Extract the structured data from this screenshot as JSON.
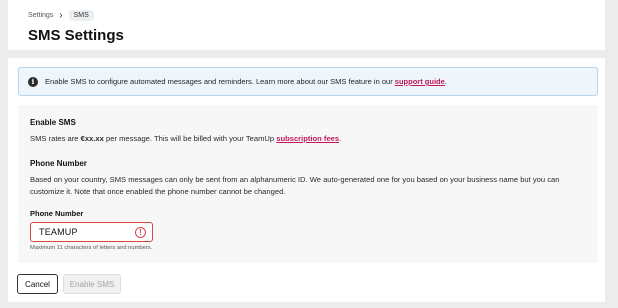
{
  "breadcrumb": {
    "parent": "Settings",
    "separator": "›",
    "current": "SMS"
  },
  "header": {
    "title": "SMS Settings"
  },
  "banner": {
    "icon": "info-icon",
    "text_before": "Enable SMS to configure automated messages and reminders. Learn more about our SMS feature in our ",
    "link_text": "support guide",
    "text_after": "."
  },
  "enable_section": {
    "title": "Enable SMS",
    "rate_before": "SMS rates are ",
    "rate_value": "€xx.xx",
    "rate_middle": " per message. This will be billed with your TeamUp ",
    "fees_link": "subscription fees",
    "rate_after": "."
  },
  "phone_section": {
    "title": "Phone Number",
    "description_line1": "Based on your country, SMS messages can only be sent from an alphanumeric ID. We auto-generated one for you based on your business name but you can",
    "description_line2": "customize it. Note that once enabled the phone number cannot be changed.",
    "field_label": "Phone Number",
    "field_value": "TEAMUP",
    "error_icon": "error-icon",
    "helper": "Maximum 11 characters of letters and numbers."
  },
  "actions": {
    "cancel_label": "Cancel",
    "enable_label": "Enable SMS"
  },
  "colors": {
    "link": "#c2185b",
    "error": "#d64545",
    "banner_bg": "#eef5fb",
    "banner_border": "#b9d3ea"
  }
}
